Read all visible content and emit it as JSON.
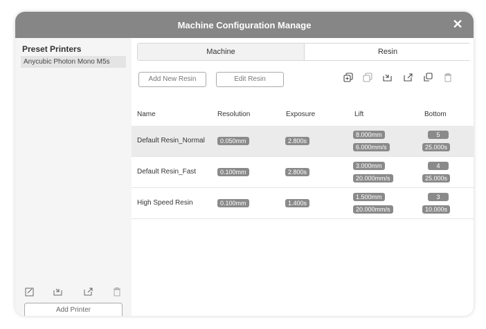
{
  "dialog": {
    "title": "Machine Configuration Manage",
    "close_glyph": "✕"
  },
  "sidebar": {
    "heading": "Preset Printers",
    "printers": [
      "Anycubic Photon Mono M5s"
    ],
    "add_printer_label": "Add Printer",
    "icons": [
      "edit-icon",
      "import-icon",
      "export-icon",
      "delete-icon"
    ]
  },
  "tabs": [
    {
      "label": "Machine",
      "active": false
    },
    {
      "label": "Resin",
      "active": true
    }
  ],
  "toolbar": {
    "add_label": "Add New Resin",
    "edit_label": "Edit Resin",
    "icons": [
      "copy-icon",
      "duplicate-icon",
      "import-icon",
      "export-icon",
      "sync-icon",
      "delete-icon"
    ]
  },
  "table": {
    "headers": [
      "Name",
      "Resolution",
      "Exposure",
      "Lift",
      "Bottom"
    ],
    "rows": [
      {
        "name": "Default Resin_Normal",
        "resolution": "0.050mm",
        "exposure": "2.800s",
        "lift_height": "8.000mm",
        "lift_speed": "6.000mm/s",
        "bottom_layers": "5",
        "bottom_exposure": "25.000s",
        "selected": true
      },
      {
        "name": "Default Resin_Fast",
        "resolution": "0.100mm",
        "exposure": "2.800s",
        "lift_height": "3.000mm",
        "lift_speed": "20.000mm/s",
        "bottom_layers": "4",
        "bottom_exposure": "25.000s",
        "selected": false
      },
      {
        "name": "High Speed Resin",
        "resolution": "0.100mm",
        "exposure": "1.400s",
        "lift_height": "1.500mm",
        "lift_speed": "20.000mm/s",
        "bottom_layers": "3",
        "bottom_exposure": "10.000s",
        "selected": false
      }
    ]
  },
  "colors": {
    "titlebar": "#868686",
    "chip": "#8a8a8a",
    "sidebar": "#f5f5f5",
    "selected_row": "#ebebeb"
  }
}
